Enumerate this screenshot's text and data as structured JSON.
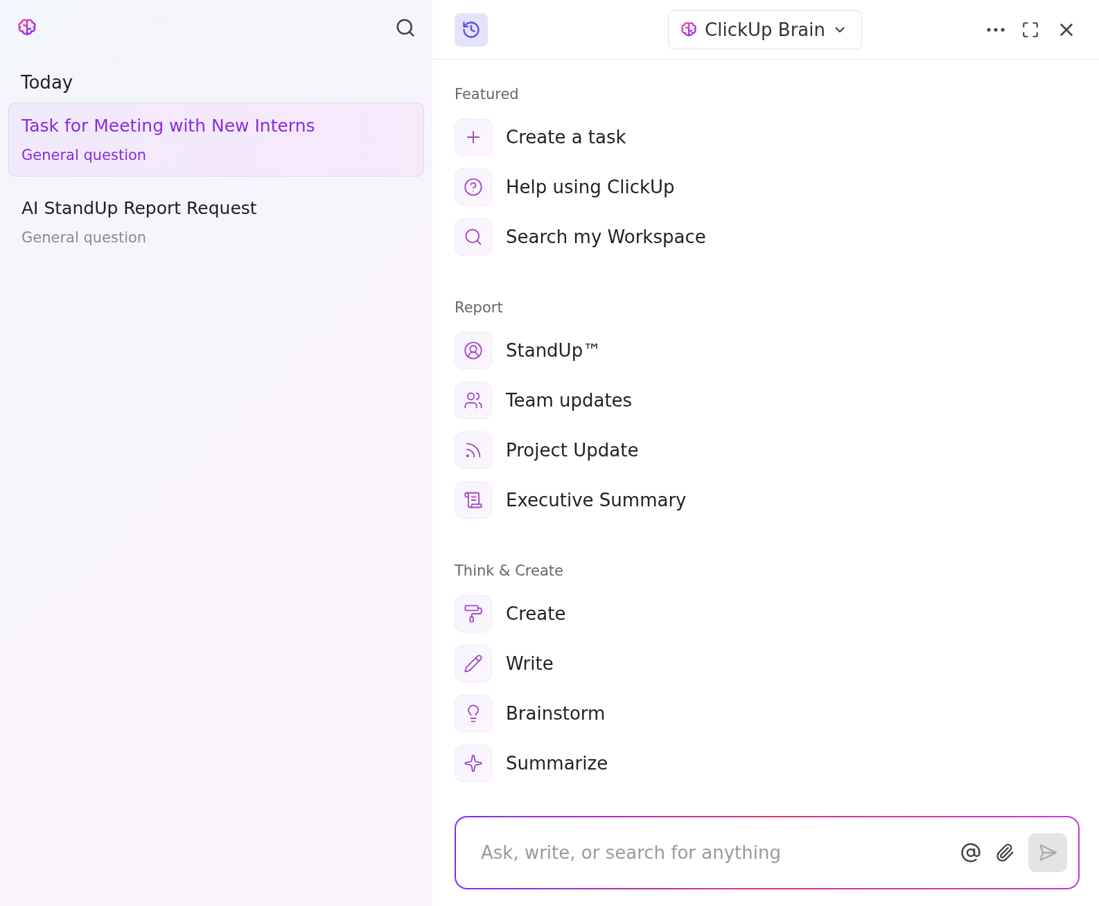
{
  "sidebar": {
    "heading": "Today",
    "conversations": [
      {
        "title": "Task for Meeting with New Interns",
        "subtitle": "General question",
        "selected": true
      },
      {
        "title": "AI StandUp Report Request",
        "subtitle": "General question",
        "selected": false
      }
    ]
  },
  "header": {
    "assistant": "ClickUp Brain"
  },
  "sections": [
    {
      "title": "Featured",
      "items": [
        "Create a task",
        "Help using ClickUp",
        "Search my Workspace"
      ]
    },
    {
      "title": "Report",
      "items": [
        "StandUp™",
        "Team updates",
        "Project Update",
        "Executive Summary"
      ]
    },
    {
      "title": "Think & Create",
      "items": [
        "Create",
        "Write",
        "Brainstorm",
        "Summarize"
      ]
    }
  ],
  "composer": {
    "placeholder": "Ask, write, or search for anything"
  }
}
